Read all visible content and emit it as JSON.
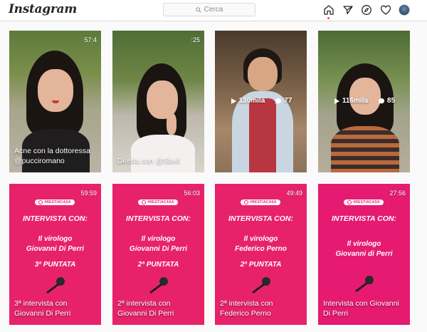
{
  "app": {
    "logo": "Instagram",
    "search_placeholder": "Cerca",
    "nav_icons": [
      "home-icon",
      "direct-icon",
      "explore-icon",
      "activity-icon",
      "profile-avatar"
    ]
  },
  "colors": {
    "accent_pink": "#e8226a",
    "notification_dot": "#ed4956"
  },
  "posts_row1": [
    {
      "duration": "57:4",
      "caption": "Acne con la dottoressa @pucciromano"
    },
    {
      "duration": ":25",
      "caption": "Diretta con @Sbvil"
    },
    {
      "views": "130mila",
      "comments": "77"
    },
    {
      "views": "116mila",
      "comments": "85"
    }
  ],
  "posts_row2": [
    {
      "duration": "59:59",
      "brand": "#RESTIACASA",
      "heading": "INTERVISTA CON:",
      "guest_line1": "Il virologo",
      "guest_line2": "Giovanni Di Perri",
      "episode": "3ª PUNTATA",
      "caption": "3ª intervista con Giovanni Di Perri"
    },
    {
      "duration": "56:03",
      "brand": "#RESTIACASA",
      "heading": "INTERVISTA CON:",
      "guest_line1": "Il virologo",
      "guest_line2": "Giovanni Di Perri",
      "episode": "2ª PUNTATA",
      "caption": "2ª intervista con Giovanni Di Perri"
    },
    {
      "duration": "49:49",
      "brand": "#RESTIACASA",
      "heading": "INTERVISTA CON:",
      "guest_line1": "Il virologo",
      "guest_line2": "Federico Perno",
      "episode": "2ª PUNTATA",
      "caption": "2ª intervista con Federico Perno"
    },
    {
      "duration": "27:56",
      "brand": "#RESTIACASA",
      "heading": "INTERVISTA CON:",
      "guest_line1": "Il virologo",
      "guest_line2": "Giovanni di Perri",
      "episode": "",
      "caption": "Intervista con Giovanni Di Perri"
    }
  ]
}
